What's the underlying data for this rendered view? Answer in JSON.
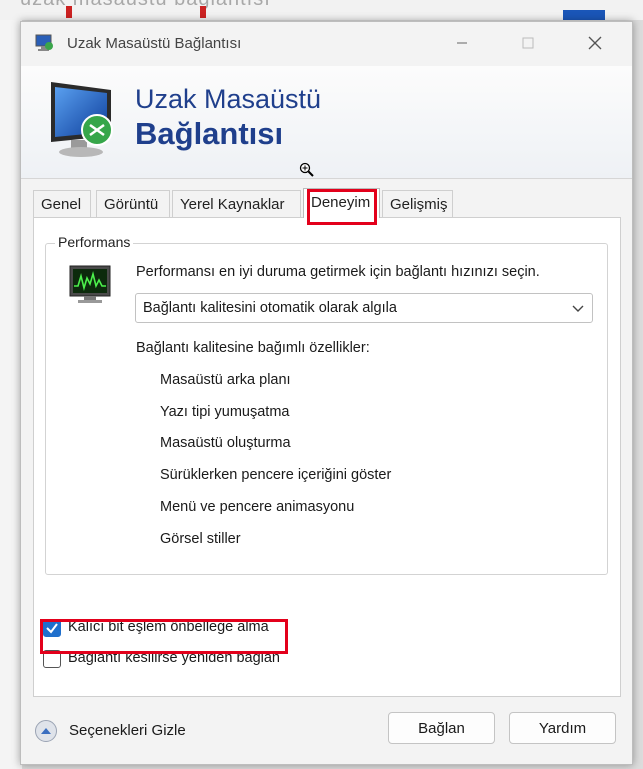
{
  "background": {
    "partial_text": "uzak masaüstü bağlantısı"
  },
  "window": {
    "title": "Uzak Masaüstü Bağlantısı",
    "controls": {
      "minimize": "—",
      "maximize": "☐",
      "close": "✕"
    }
  },
  "banner": {
    "line1": "Uzak Masaüstü",
    "line2": "Bağlantısı",
    "brand_color": "#1f3f8c"
  },
  "tabs": [
    {
      "label": "Genel",
      "active": false
    },
    {
      "label": "Görüntü",
      "active": false
    },
    {
      "label": "Yerel Kaynaklar",
      "active": false
    },
    {
      "label": "Deneyim",
      "active": true
    },
    {
      "label": "Gelişmiş",
      "active": false
    }
  ],
  "performance": {
    "legend": "Performans",
    "description": "Performansı en iyi duruma getirmek için bağlantı hızınızı seçin.",
    "connection_speed": {
      "selected": "Bağlantı kalitesini otomatik olarak algıla"
    },
    "features_title": "Bağlantı kalitesine bağımlı özellikler:",
    "features": [
      "Masaüstü arka planı",
      "Yazı tipi yumuşatma",
      "Masaüstü oluşturma",
      "Sürüklerken pencere içeriğini göster",
      "Menü ve pencere animasyonu",
      "Görsel stiller"
    ]
  },
  "checkboxes": {
    "bitmap_cache": {
      "label": "Kalıcı bit eşlem önbelleğe alma",
      "checked": true
    },
    "reconnect": {
      "label": "Bağlantı kesilirse yeniden bağlan",
      "checked": false
    }
  },
  "footer": {
    "toggle_label": "Seçenekleri Gizle",
    "connect": "Bağlan",
    "help": "Yardım"
  },
  "colors": {
    "highlight": "#e3001b",
    "checkbox_accent": "#1f6fcc"
  }
}
